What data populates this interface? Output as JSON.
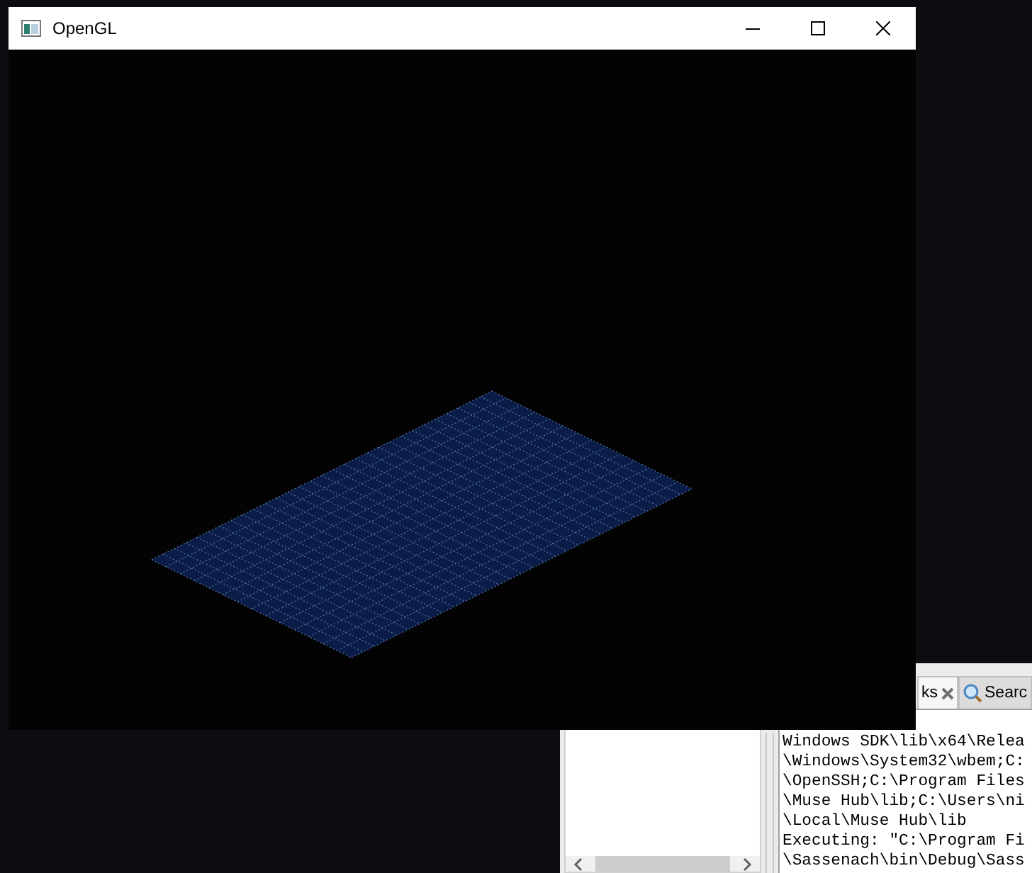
{
  "opengl_window": {
    "title": "OpenGL"
  },
  "ide_window": {
    "tabs": [
      {
        "label": "ks",
        "kind": "closable",
        "selected": true
      },
      {
        "label": "Searc",
        "kind": "search",
        "selected": false
      }
    ],
    "output_lines": [
      "Windows SDK\\lib\\x64\\Relea",
      "\\Windows\\System32\\wbem;C:",
      "\\OpenSSH;C:\\Program Files",
      "\\Muse Hub\\lib;C:\\Users\\ni",
      "\\Local\\Muse Hub\\lib",
      "Executing: \"C:\\Program Fi",
      "\\Sassenach\\bin\\Debug\\Sass"
    ]
  }
}
